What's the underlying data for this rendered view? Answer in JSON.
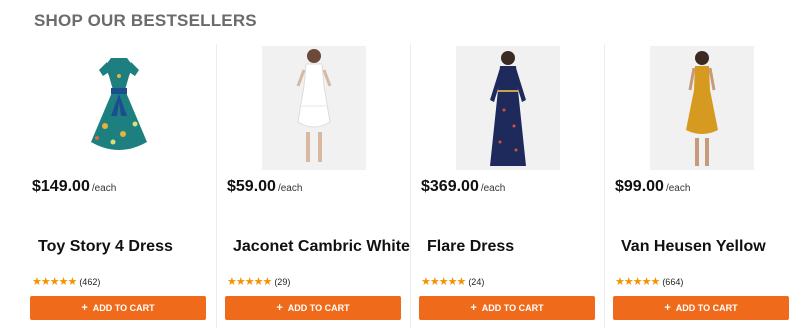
{
  "section": {
    "title": "SHOP OUR BESTSELLERS"
  },
  "theme": {
    "accent": "#ef6a1a",
    "star": "#f39200"
  },
  "products": [
    {
      "name": "Toy Story 4 Dress",
      "price": "$149.00",
      "unit": "/each",
      "stars": "★★★★★",
      "rating_count": "(462)",
      "cart_label": "ADD TO CART",
      "cart_icon": "plus-icon",
      "image_alt": "teal floral dress"
    },
    {
      "name": "Jaconet Cambric White",
      "price": "$59.00",
      "unit": "/each",
      "stars": "★★★★★",
      "rating_count": "(29)",
      "cart_label": "ADD TO CART",
      "cart_icon": "plus-icon",
      "image_alt": "white lace dress"
    },
    {
      "name": "Flare Dress",
      "price": "$369.00",
      "unit": "/each",
      "stars": "★★★★★",
      "rating_count": "(24)",
      "cart_label": "ADD TO CART",
      "cart_icon": "plus-icon",
      "image_alt": "navy printed maxi dress"
    },
    {
      "name": "Van Heusen Yellow",
      "price": "$99.00",
      "unit": "/each",
      "stars": "★★★★★",
      "rating_count": "(664)",
      "cart_label": "ADD TO CART",
      "cart_icon": "plus-icon",
      "image_alt": "mustard yellow dress"
    }
  ]
}
